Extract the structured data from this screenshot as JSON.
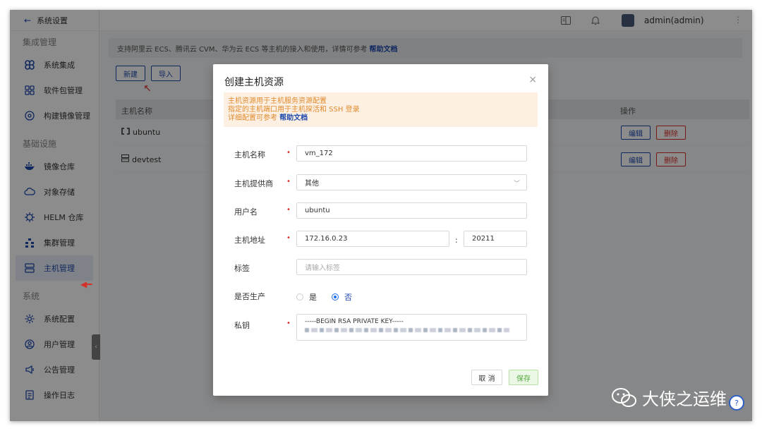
{
  "sidebar": {
    "back_label": "系统设置",
    "groups": [
      {
        "title": "集成管理",
        "items": [
          {
            "label": "系统集成",
            "icon": "command-icon"
          },
          {
            "label": "软件包管理",
            "icon": "grid-icon"
          },
          {
            "label": "构建镜像管理",
            "icon": "disc-icon"
          }
        ]
      },
      {
        "title": "基础设施",
        "items": [
          {
            "label": "镜像仓库",
            "icon": "docker-icon"
          },
          {
            "label": "对象存储",
            "icon": "cloud-icon"
          },
          {
            "label": "HELM 仓库",
            "icon": "helm-icon"
          },
          {
            "label": "集群管理",
            "icon": "cluster-icon"
          },
          {
            "label": "主机管理",
            "icon": "server-icon",
            "active": true
          }
        ]
      },
      {
        "title": "系统",
        "items": [
          {
            "label": "系统配置",
            "icon": "settings-icon"
          },
          {
            "label": "用户管理",
            "icon": "user-icon"
          },
          {
            "label": "公告管理",
            "icon": "megaphone-icon"
          },
          {
            "label": "操作日志",
            "icon": "log-icon"
          }
        ]
      }
    ]
  },
  "topbar": {
    "user": "admin(admin)"
  },
  "notice": {
    "text": "支持阿里云 ECS、腾讯云 CVM、华为云 ECS 等主机的接入和使用，详情可参考",
    "link": "帮助文档"
  },
  "toolbar": {
    "new_label": "新建",
    "import_label": "导入"
  },
  "table": {
    "col_name": "主机名称",
    "col_actions": "操作",
    "rows": [
      {
        "name": "ubuntu",
        "icon": "ubuntu-icon",
        "edit": "编辑",
        "delete": "删除"
      },
      {
        "name": "devtest",
        "icon": "server-icon",
        "edit": "编辑",
        "delete": "删除"
      }
    ]
  },
  "dialog": {
    "title": "创建主机资源",
    "tip_line1": "主机资源用于主机服务资源配置",
    "tip_line2": "指定的主机端口用于主机探活和 SSH 登录",
    "tip_line3": "详细配置可参考",
    "tip_link": "帮助文档",
    "fields": {
      "hostname_label": "主机名称",
      "hostname_value": "vm_172",
      "provider_label": "主机提供商",
      "provider_value": "其他",
      "username_label": "用户名",
      "username_value": "ubuntu",
      "address_label": "主机地址",
      "address_value": "172.16.0.23",
      "port_value": "20211",
      "colon": ":",
      "tag_label": "标签",
      "tag_placeholder": "请输入标签",
      "production_label": "是否生产",
      "production_yes": "是",
      "production_no": "否",
      "production_selected": "否",
      "private_key_label": "私钥",
      "private_key_value": "-----BEGIN RSA PRIVATE KEY-----"
    },
    "cancel_label": "取 消",
    "save_label": "保存"
  },
  "watermark": {
    "text": "大侠之运维"
  },
  "colors": {
    "primary": "#1f4aad",
    "danger": "#d6302b",
    "warning_bg": "#fdf0e3",
    "warning_text": "#e08a2c"
  }
}
